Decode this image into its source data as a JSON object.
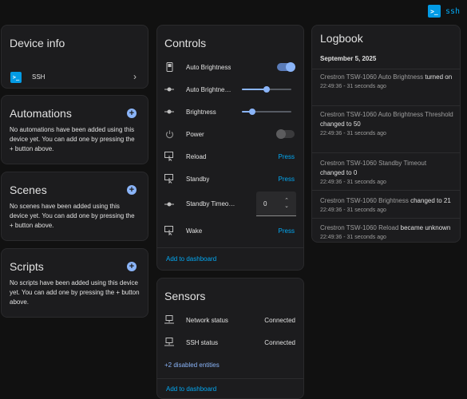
{
  "top": {
    "ssh_label": "ssh",
    "ssh_icon": "terminal-icon"
  },
  "device_info": {
    "title": "Device info",
    "integration": {
      "label": "SSH",
      "icon": "terminal-icon"
    }
  },
  "automations": {
    "title": "Automations",
    "description": "No automations have been added using this device yet. You can add one by pressing the + button above."
  },
  "scenes": {
    "title": "Scenes",
    "description": "No scenes have been added using this device yet. You can add one by pressing the + button above."
  },
  "scripts": {
    "title": "Scripts",
    "description": "No scripts have been added using this device yet. You can add one by pressing the + button above."
  },
  "controls": {
    "title": "Controls",
    "rows": [
      {
        "label": "Auto Brightness",
        "icon": "phone-icon",
        "type": "toggle",
        "on": true
      },
      {
        "label": "Auto Brightne…",
        "icon": "slider-icon",
        "type": "slider",
        "value": 0.5
      },
      {
        "label": "Brightness",
        "icon": "slider-icon",
        "type": "slider",
        "value": 0.21
      },
      {
        "label": "Power",
        "icon": "power-icon",
        "type": "toggle",
        "on": false
      },
      {
        "label": "Reload",
        "icon": "button-press-icon",
        "type": "press",
        "action": "Press"
      },
      {
        "label": "Standby",
        "icon": "button-press-icon",
        "type": "press",
        "action": "Press"
      },
      {
        "label": "Standby Timeo…",
        "icon": "slider-icon",
        "type": "number",
        "value": "0"
      },
      {
        "label": "Wake",
        "icon": "button-press-icon",
        "type": "press",
        "action": "Press"
      }
    ],
    "add_to_dashboard": "Add to dashboard"
  },
  "sensors": {
    "title": "Sensors",
    "rows": [
      {
        "label": "Network status",
        "value": "Connected",
        "icon": "network-icon"
      },
      {
        "label": "SSH status",
        "value": "Connected",
        "icon": "network-icon"
      }
    ],
    "disabled_link": "+2 disabled entities",
    "add_to_dashboard": "Add to dashboard"
  },
  "logbook": {
    "title": "Logbook",
    "date": "September 5, 2025",
    "entries": [
      {
        "entity": "Crestron TSW-1060 Auto Brightness",
        "action": "turned on",
        "time": "22:49:36 - 31 seconds ago"
      },
      {
        "entity": "Crestron TSW-1060 Auto Brightness Threshold",
        "action": "changed to 50",
        "time": "22:49:36 - 31 seconds ago"
      },
      {
        "entity": "Crestron TSW-1060 Standby Timeout",
        "action": "changed to 0",
        "time": "22:49:36 - 31 seconds ago"
      },
      {
        "entity": "Crestron TSW-1060 Brightness",
        "action": "changed to 21",
        "time": "22:49:36 - 31 seconds ago"
      },
      {
        "entity": "Crestron TSW-1060 Reload",
        "action": "became unknown",
        "time": "22:49:36 - 31 seconds ago"
      }
    ]
  },
  "colors": {
    "accent": "#03a9f4",
    "slider": "#8ab4f8",
    "card": "#1c1c1e",
    "background": "#111111"
  }
}
